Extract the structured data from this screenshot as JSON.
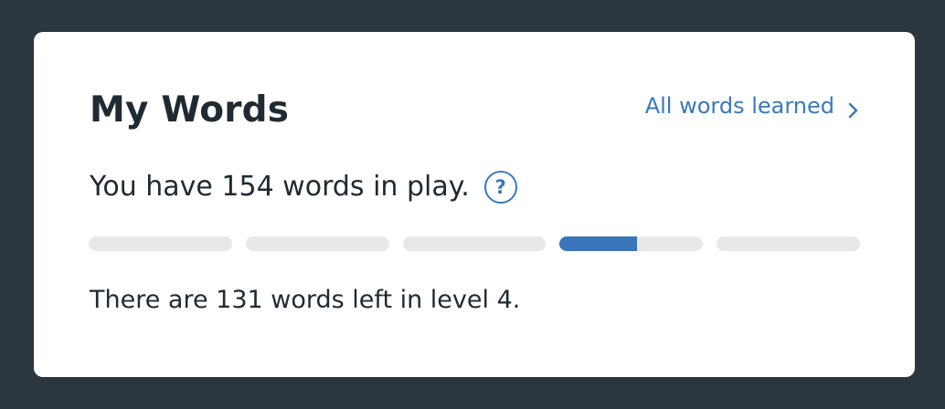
{
  "card": {
    "title": "My Words",
    "all_words_link": {
      "label": "All words learned",
      "icon": "chevron-right-icon"
    },
    "summary": "You have 154 words in play.",
    "help_icon": {
      "glyph": "?",
      "icon": "question-circle-icon"
    },
    "accent_color": "#3a78bd",
    "progress": {
      "total_levels": 5,
      "current_level": 4,
      "levels": [
        {
          "level": 1,
          "fraction": 0
        },
        {
          "level": 2,
          "fraction": 0
        },
        {
          "level": 3,
          "fraction": 0
        },
        {
          "level": 4,
          "fraction": 0.54
        },
        {
          "level": 5,
          "fraction": 0
        }
      ]
    },
    "remaining_text": "There are 131 words left in level 4."
  }
}
